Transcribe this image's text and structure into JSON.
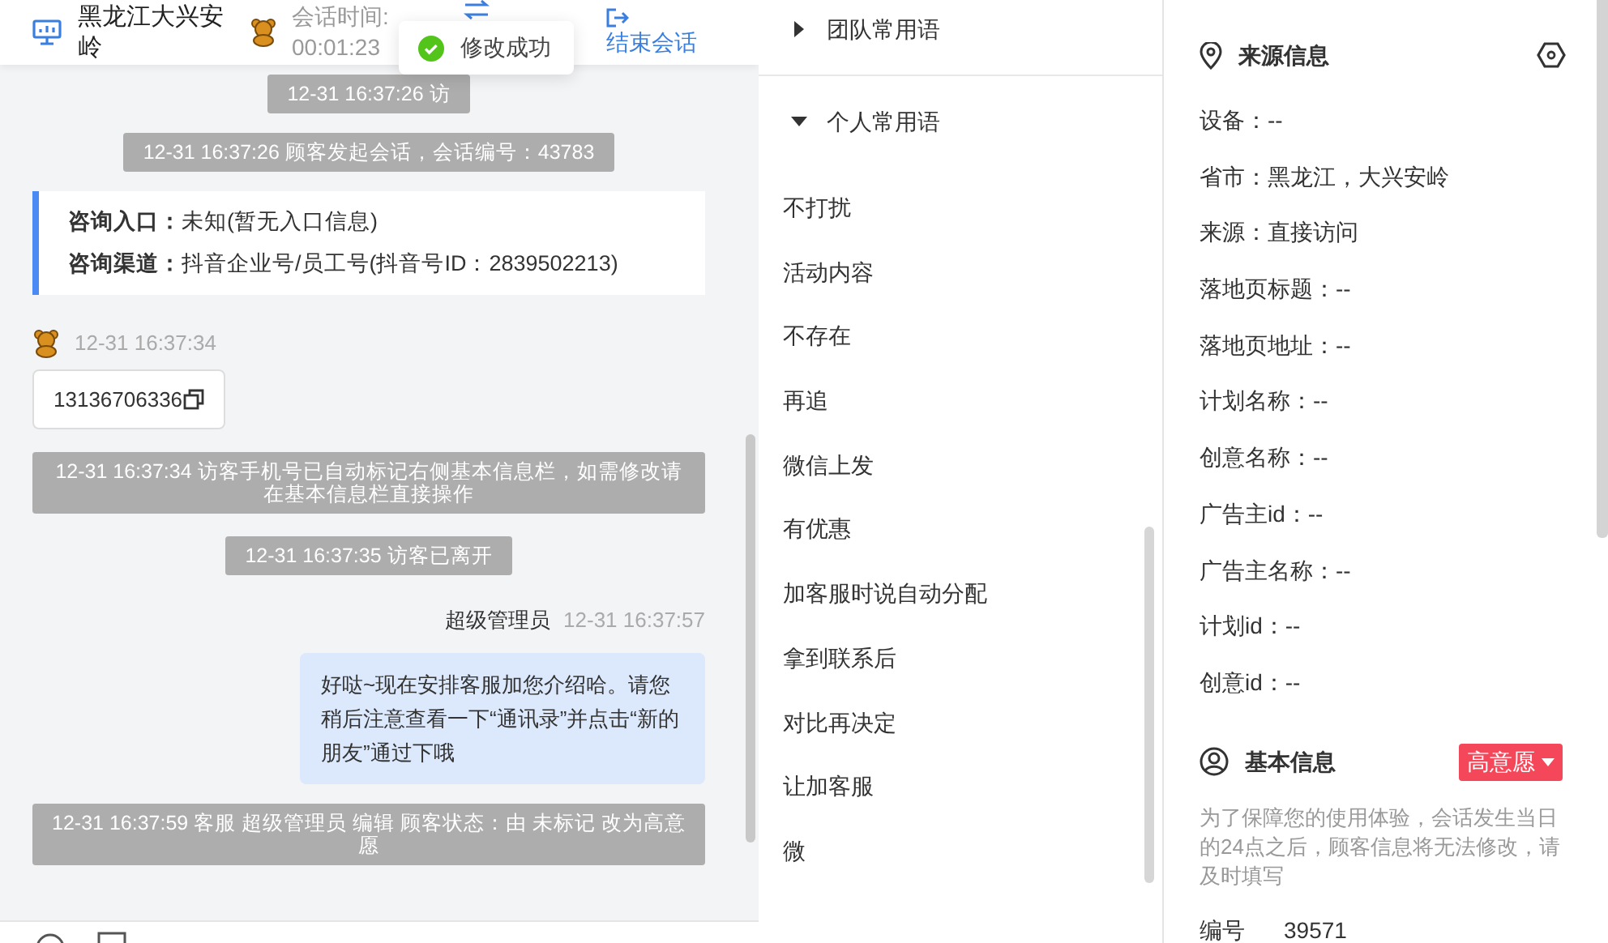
{
  "chat_header": {
    "location": "黑龙江大兴安岭",
    "session_time_label": "会话时间:",
    "session_time": "00:01:23",
    "end_button": "结束会话"
  },
  "toast": {
    "text": "修改成功"
  },
  "messages": [
    {
      "kind": "system",
      "text": "12-31 16:37:26 访"
    },
    {
      "kind": "system",
      "text": "12-31 16:37:26 顾客发起会话，会话编号：43783"
    },
    {
      "kind": "info_card",
      "rows": [
        {
          "label": "咨询入口：",
          "value": "未知(暂无入口信息)"
        },
        {
          "label": "咨询渠道：",
          "value": "抖音企业号/员工号(抖音号ID：2839502213)"
        }
      ]
    },
    {
      "kind": "visitor",
      "time": "12-31 16:37:34",
      "text": "13136706336"
    },
    {
      "kind": "system",
      "text": "12-31 16:37:34 访客手机号已自动标记右侧基本信息栏，如需修改请在基本信息栏直接操作"
    },
    {
      "kind": "system",
      "text": "12-31 16:37:35 访客已离开"
    },
    {
      "kind": "agent",
      "name": "超级管理员",
      "time": "12-31 16:37:57",
      "text": "好哒~现在安排客服加您介绍哈。请您稍后注意查看一下“通讯录”并点击“新的朋友”通过下哦"
    },
    {
      "kind": "system",
      "text": "12-31 16:37:59 客服 超级管理员 编辑 顾客状态：由 未标记 改为高意愿"
    }
  ],
  "phrases": {
    "groups": [
      {
        "title": "团队常用语",
        "expanded": false
      },
      {
        "title": "个人常用语",
        "expanded": true,
        "items": [
          "不打扰",
          "活动内容",
          "不存在",
          "再追",
          "微信上发",
          "有优惠",
          "加客服时说自动分配",
          "拿到联系后",
          "对比再决定",
          "让加客服",
          "微"
        ]
      }
    ]
  },
  "source_info": {
    "title": "来源信息",
    "rows": [
      "设备：--",
      "省市：黑龙江，大兴安岭",
      "来源：直接访问",
      "落地页标题：--",
      "落地页地址：--",
      "计划名称：--",
      "创意名称：--",
      "广告主id：--",
      "广告主名称：--",
      "计划id：--",
      "创意id：--"
    ]
  },
  "basic_info": {
    "title": "基本信息",
    "tag": {
      "label": "高意愿",
      "color": "#f5475a"
    },
    "note": "为了保障您的使用体验，会话发生当日的24点之后，顾客信息将无法修改，请及时填写",
    "fields": [
      {
        "label": "编号",
        "value": "39571"
      }
    ]
  }
}
